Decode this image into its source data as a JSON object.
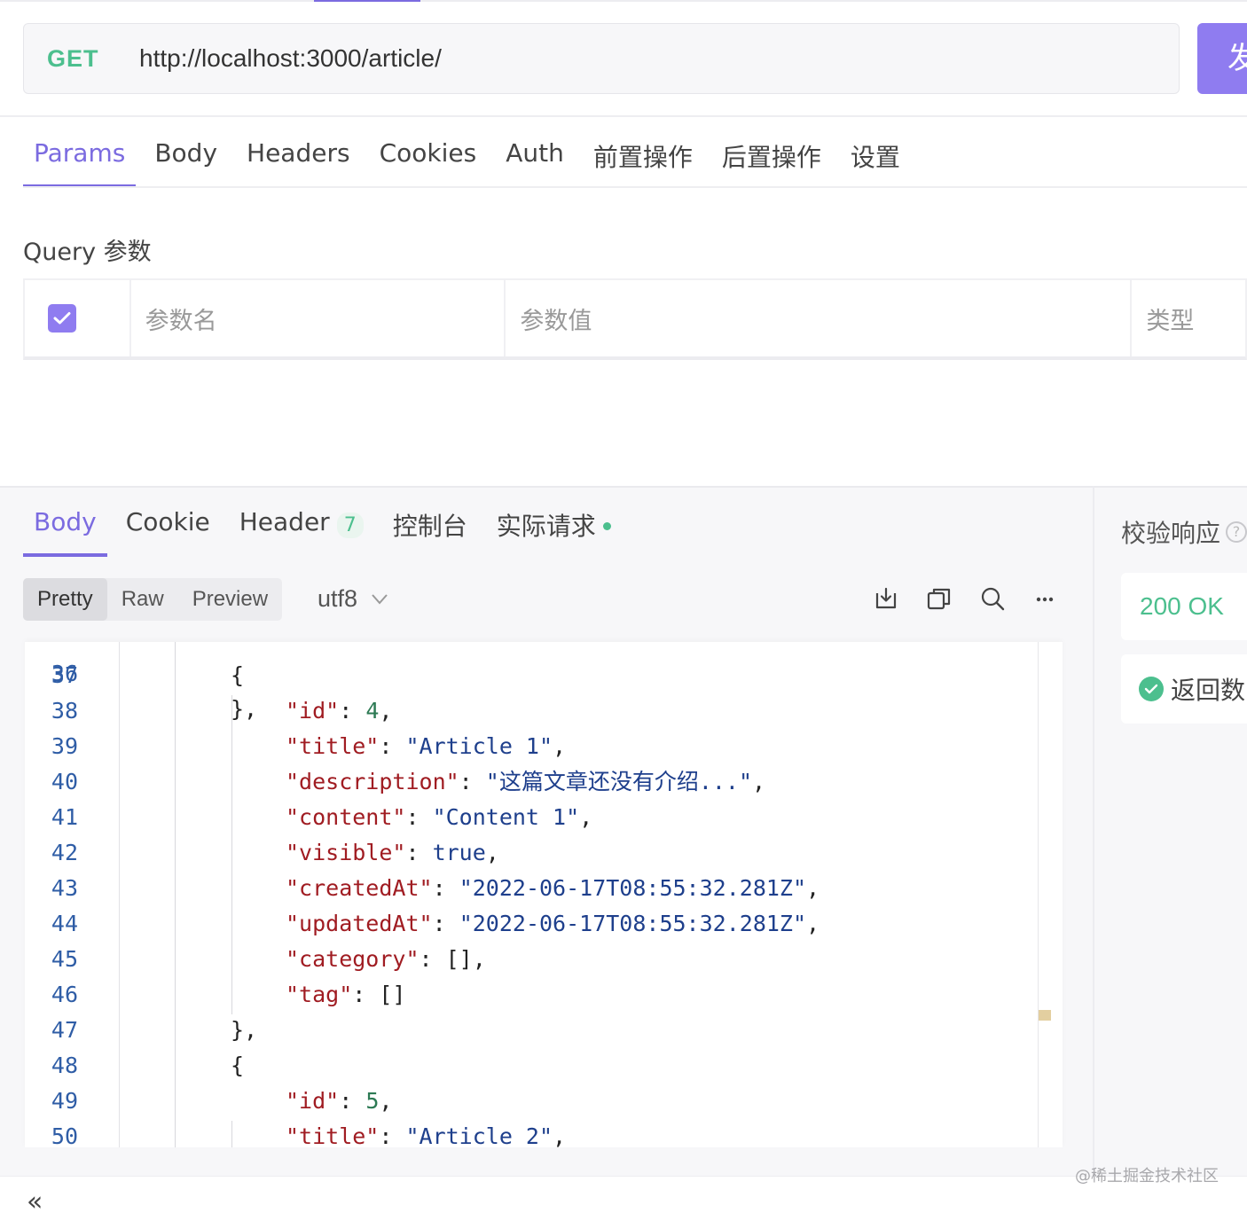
{
  "request": {
    "method": "GET",
    "url": "http://localhost:3000/article/",
    "send_label": "发"
  },
  "request_tabs": [
    "Params",
    "Body",
    "Headers",
    "Cookies",
    "Auth",
    "前置操作",
    "后置操作",
    "设置"
  ],
  "query": {
    "title": "Query 参数",
    "columns": [
      "参数名",
      "参数值",
      "类型"
    ],
    "select_all_checked": true
  },
  "response_tabs": {
    "body": "Body",
    "cookie": "Cookie",
    "header": "Header",
    "header_count": "7",
    "console": "控制台",
    "actual_request": "实际请求"
  },
  "format": {
    "options": [
      "Pretty",
      "Raw",
      "Preview"
    ],
    "selected": "Pretty",
    "encoding": "utf8"
  },
  "toolbar_icons": [
    "download-icon",
    "copy-icon",
    "search-icon",
    "more-icon"
  ],
  "code_lines": [
    {
      "ln": "37",
      "tokens": [
        [
          "p",
          "{"
        ]
      ]
    },
    {
      "ln": "38",
      "tokens": [
        [
          "k",
          "\"id\""
        ],
        [
          "p",
          ": "
        ],
        [
          "n",
          "4"
        ],
        [
          "p",
          ","
        ]
      ]
    },
    {
      "ln": "39",
      "tokens": [
        [
          "k",
          "\"title\""
        ],
        [
          "p",
          ": "
        ],
        [
          "s",
          "\"Article 1\""
        ],
        [
          "p",
          ","
        ]
      ]
    },
    {
      "ln": "40",
      "tokens": [
        [
          "k",
          "\"description\""
        ],
        [
          "p",
          ": "
        ],
        [
          "s",
          "\"这篇文章还没有介绍...\""
        ],
        [
          "p",
          ","
        ]
      ]
    },
    {
      "ln": "41",
      "tokens": [
        [
          "k",
          "\"content\""
        ],
        [
          "p",
          ": "
        ],
        [
          "s",
          "\"Content 1\""
        ],
        [
          "p",
          ","
        ]
      ]
    },
    {
      "ln": "42",
      "tokens": [
        [
          "k",
          "\"visible\""
        ],
        [
          "p",
          ": "
        ],
        [
          "b",
          "true"
        ],
        [
          "p",
          ","
        ]
      ]
    },
    {
      "ln": "43",
      "tokens": [
        [
          "k",
          "\"createdAt\""
        ],
        [
          "p",
          ": "
        ],
        [
          "s",
          "\"2022-06-17T08:55:32.281Z\""
        ],
        [
          "p",
          ","
        ]
      ]
    },
    {
      "ln": "44",
      "tokens": [
        [
          "k",
          "\"updatedAt\""
        ],
        [
          "p",
          ": "
        ],
        [
          "s",
          "\"2022-06-17T08:55:32.281Z\""
        ],
        [
          "p",
          ","
        ]
      ]
    },
    {
      "ln": "45",
      "tokens": [
        [
          "k",
          "\"category\""
        ],
        [
          "p",
          ": [],"
        ]
      ]
    },
    {
      "ln": "46",
      "tokens": [
        [
          "k",
          "\"tag\""
        ],
        [
          "p",
          ": []"
        ]
      ]
    },
    {
      "ln": "47",
      "tokens": [
        [
          "p",
          "},"
        ]
      ]
    },
    {
      "ln": "48",
      "tokens": [
        [
          "p",
          "{"
        ]
      ]
    },
    {
      "ln": "49",
      "tokens": [
        [
          "k",
          "\"id\""
        ],
        [
          "p",
          ": "
        ],
        [
          "n",
          "5"
        ],
        [
          "p",
          ","
        ]
      ]
    },
    {
      "ln": "50",
      "tokens": [
        [
          "k",
          "\"title\""
        ],
        [
          "p",
          ": "
        ],
        [
          "s",
          "\"Article 2\""
        ],
        [
          "p",
          ","
        ]
      ]
    }
  ],
  "validation": {
    "title": "校验响应",
    "status": "200 OK",
    "check_label": "返回数"
  },
  "watermark": "@稀土掘金技术社区",
  "colors": {
    "accent": "#7b6be0",
    "success": "#4cbf8e",
    "json_key": "#a01c22",
    "json_string": "#1e3f8c",
    "json_number": "#2d7a54"
  }
}
